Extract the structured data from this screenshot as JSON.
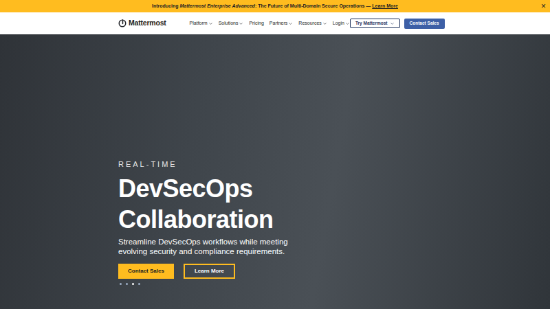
{
  "banner": {
    "prefix": "Introducing ",
    "emphasis": "Mattermost Enterprise Advanced",
    "suffix": ": The Future of Multi-Domain Secure Operations — ",
    "link": "Learn More",
    "close": "×"
  },
  "nav": {
    "logo": "Mattermost",
    "items": [
      {
        "label": "Platform",
        "has_menu": true
      },
      {
        "label": "Solutions",
        "has_menu": true
      },
      {
        "label": "Pricing",
        "has_menu": false
      },
      {
        "label": "Partners",
        "has_menu": true
      },
      {
        "label": "Resources",
        "has_menu": true
      },
      {
        "label": "Login",
        "has_menu": true
      }
    ],
    "try_button": "Try Mattermost",
    "contact_button": "Contact Sales"
  },
  "hero": {
    "eyebrow": "REAL-TIME",
    "title_lines": [
      "DevSecOps",
      "Collaboration"
    ],
    "subtitle": "Streamline DevSecOps workflows while meeting evolving security and compliance requirements.",
    "primary_button": "Contact Sales",
    "secondary_button": "Learn More",
    "dots": [
      {
        "selected": false
      },
      {
        "selected": false
      },
      {
        "selected": true
      },
      {
        "selected": false
      }
    ]
  }
}
